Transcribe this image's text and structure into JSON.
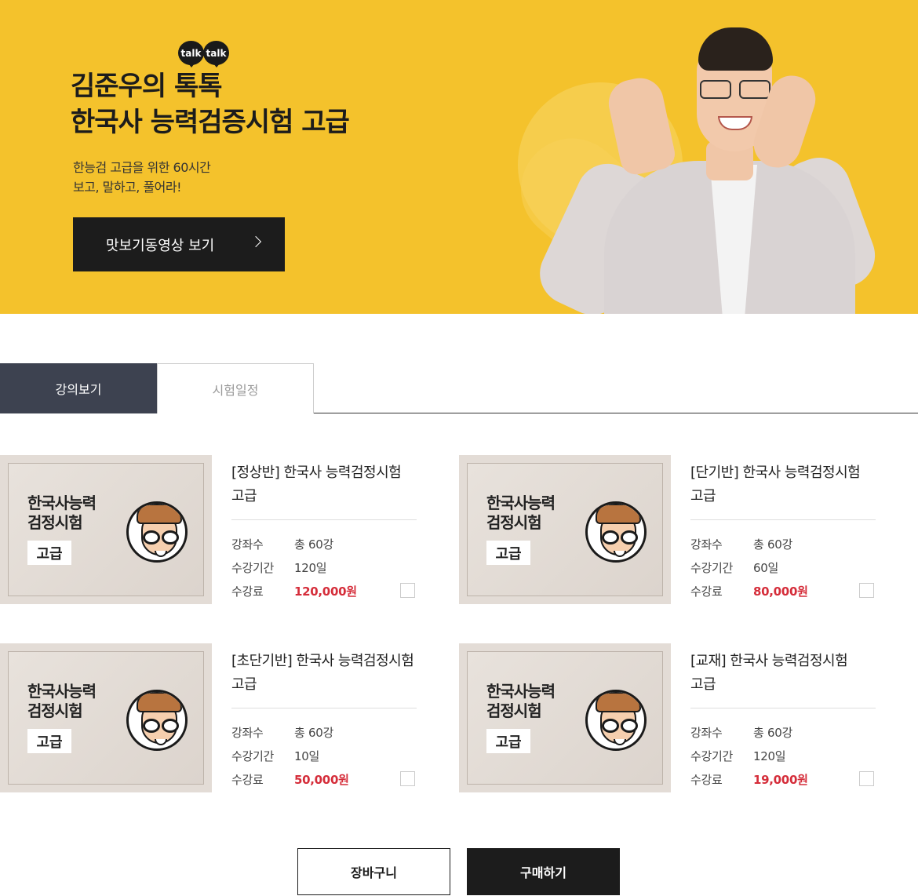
{
  "hero": {
    "talk_badges": [
      "talk",
      "talk"
    ],
    "title_line1": "김준우의 톡톡",
    "title_line2": "한국사 능력검증시험 고급",
    "sub_line1": "한능검 고급을 위한 60시간",
    "sub_line2": "보고, 말하고, 풀어라!",
    "button_label": "맛보기동영상 보기",
    "background_color": "#f4c22c"
  },
  "tabs": [
    {
      "label": "강의보기",
      "active": true
    },
    {
      "label": "시험일정",
      "active": false
    }
  ],
  "courses": [
    {
      "thumb_title_line1": "한국사능력",
      "thumb_title_line2": "검정시험",
      "thumb_badge": "고급",
      "title_line1": "[정상반] 한국사 능력검정시험",
      "title_line2": "고급",
      "rows": [
        {
          "key": "강좌수",
          "value": "총 60강"
        },
        {
          "key": "수강기간",
          "value": "120일"
        },
        {
          "key": "수강료",
          "value": "120,000원"
        }
      ]
    },
    {
      "thumb_title_line1": "한국사능력",
      "thumb_title_line2": "검정시험",
      "thumb_badge": "고급",
      "title_line1": "[단기반] 한국사 능력검정시험",
      "title_line2": "고급",
      "rows": [
        {
          "key": "강좌수",
          "value": "총 60강"
        },
        {
          "key": "수강기간",
          "value": "60일"
        },
        {
          "key": "수강료",
          "value": "80,000원"
        }
      ]
    },
    {
      "thumb_title_line1": "한국사능력",
      "thumb_title_line2": "검정시험",
      "thumb_badge": "고급",
      "title_line1": "[초단기반] 한국사 능력검정시험",
      "title_line2": "고급",
      "rows": [
        {
          "key": "강좌수",
          "value": "총 60강"
        },
        {
          "key": "수강기간",
          "value": "10일"
        },
        {
          "key": "수강료",
          "value": "50,000원"
        }
      ]
    },
    {
      "thumb_title_line1": "한국사능력",
      "thumb_title_line2": "검정시험",
      "thumb_badge": "고급",
      "title_line1": "[교재] 한국사 능력검정시험",
      "title_line2": "고급",
      "rows": [
        {
          "key": "강좌수",
          "value": "총 60강"
        },
        {
          "key": "수강기간",
          "value": "120일"
        },
        {
          "key": "수강료",
          "value": "19,000원"
        }
      ]
    }
  ],
  "actions": {
    "cart_label": "장바구니",
    "buy_label": "구매하기"
  },
  "colors": {
    "price": "#d52d3a",
    "tab_active": "#3d4250",
    "dark_button": "#1c1c1c"
  }
}
